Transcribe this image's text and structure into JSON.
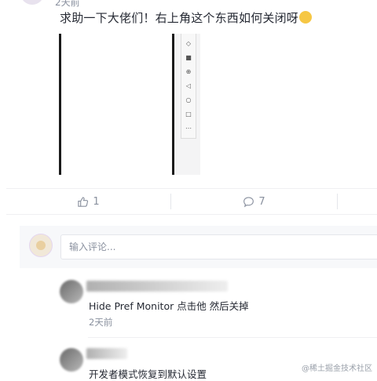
{
  "post": {
    "time_partial": "2天前",
    "text": "求助一下大佬们！右上角这个东西如何关闭呀",
    "emoji": "crying-laughing-emoji"
  },
  "image_toolbar_icons": [
    "rotate-icon",
    "camera-icon",
    "zoom-icon",
    "back-icon",
    "home-icon",
    "square-icon",
    "more-icon"
  ],
  "actions": {
    "like_count": "1",
    "comment_count": "7"
  },
  "comment_input": {
    "placeholder": "输入评论..."
  },
  "comments": [
    {
      "text": "Hide Pref Monitor 点击他 然后关掉",
      "time": "2天前"
    },
    {
      "text": "开发者模式恢复到默认设置"
    }
  ],
  "watermark": "@稀土掘金技术社区"
}
